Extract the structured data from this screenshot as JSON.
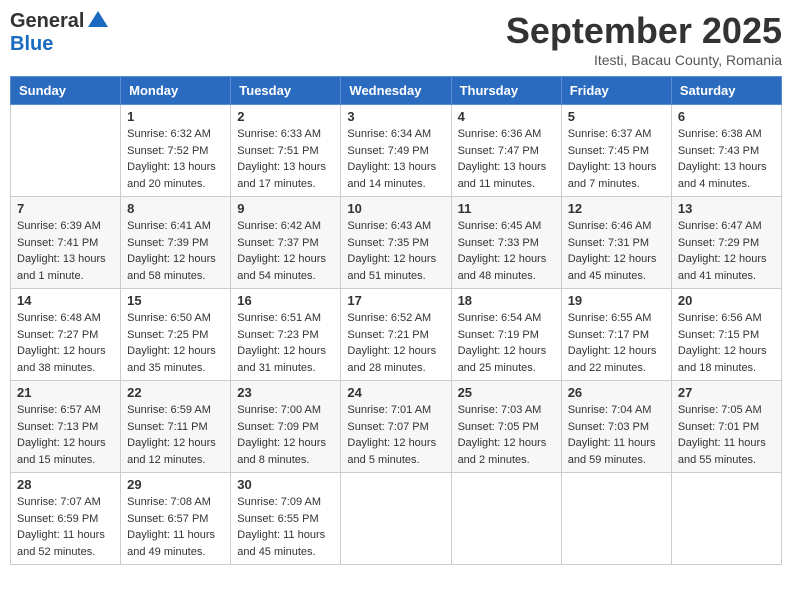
{
  "header": {
    "logo_general": "General",
    "logo_blue": "Blue",
    "month_title": "September 2025",
    "location": "Itesti, Bacau County, Romania"
  },
  "weekdays": [
    "Sunday",
    "Monday",
    "Tuesday",
    "Wednesday",
    "Thursday",
    "Friday",
    "Saturday"
  ],
  "weeks": [
    [
      {
        "day": "",
        "sunrise": "",
        "sunset": "",
        "daylight": ""
      },
      {
        "day": "1",
        "sunrise": "Sunrise: 6:32 AM",
        "sunset": "Sunset: 7:52 PM",
        "daylight": "Daylight: 13 hours and 20 minutes."
      },
      {
        "day": "2",
        "sunrise": "Sunrise: 6:33 AM",
        "sunset": "Sunset: 7:51 PM",
        "daylight": "Daylight: 13 hours and 17 minutes."
      },
      {
        "day": "3",
        "sunrise": "Sunrise: 6:34 AM",
        "sunset": "Sunset: 7:49 PM",
        "daylight": "Daylight: 13 hours and 14 minutes."
      },
      {
        "day": "4",
        "sunrise": "Sunrise: 6:36 AM",
        "sunset": "Sunset: 7:47 PM",
        "daylight": "Daylight: 13 hours and 11 minutes."
      },
      {
        "day": "5",
        "sunrise": "Sunrise: 6:37 AM",
        "sunset": "Sunset: 7:45 PM",
        "daylight": "Daylight: 13 hours and 7 minutes."
      },
      {
        "day": "6",
        "sunrise": "Sunrise: 6:38 AM",
        "sunset": "Sunset: 7:43 PM",
        "daylight": "Daylight: 13 hours and 4 minutes."
      }
    ],
    [
      {
        "day": "7",
        "sunrise": "Sunrise: 6:39 AM",
        "sunset": "Sunset: 7:41 PM",
        "daylight": "Daylight: 13 hours and 1 minute."
      },
      {
        "day": "8",
        "sunrise": "Sunrise: 6:41 AM",
        "sunset": "Sunset: 7:39 PM",
        "daylight": "Daylight: 12 hours and 58 minutes."
      },
      {
        "day": "9",
        "sunrise": "Sunrise: 6:42 AM",
        "sunset": "Sunset: 7:37 PM",
        "daylight": "Daylight: 12 hours and 54 minutes."
      },
      {
        "day": "10",
        "sunrise": "Sunrise: 6:43 AM",
        "sunset": "Sunset: 7:35 PM",
        "daylight": "Daylight: 12 hours and 51 minutes."
      },
      {
        "day": "11",
        "sunrise": "Sunrise: 6:45 AM",
        "sunset": "Sunset: 7:33 PM",
        "daylight": "Daylight: 12 hours and 48 minutes."
      },
      {
        "day": "12",
        "sunrise": "Sunrise: 6:46 AM",
        "sunset": "Sunset: 7:31 PM",
        "daylight": "Daylight: 12 hours and 45 minutes."
      },
      {
        "day": "13",
        "sunrise": "Sunrise: 6:47 AM",
        "sunset": "Sunset: 7:29 PM",
        "daylight": "Daylight: 12 hours and 41 minutes."
      }
    ],
    [
      {
        "day": "14",
        "sunrise": "Sunrise: 6:48 AM",
        "sunset": "Sunset: 7:27 PM",
        "daylight": "Daylight: 12 hours and 38 minutes."
      },
      {
        "day": "15",
        "sunrise": "Sunrise: 6:50 AM",
        "sunset": "Sunset: 7:25 PM",
        "daylight": "Daylight: 12 hours and 35 minutes."
      },
      {
        "day": "16",
        "sunrise": "Sunrise: 6:51 AM",
        "sunset": "Sunset: 7:23 PM",
        "daylight": "Daylight: 12 hours and 31 minutes."
      },
      {
        "day": "17",
        "sunrise": "Sunrise: 6:52 AM",
        "sunset": "Sunset: 7:21 PM",
        "daylight": "Daylight: 12 hours and 28 minutes."
      },
      {
        "day": "18",
        "sunrise": "Sunrise: 6:54 AM",
        "sunset": "Sunset: 7:19 PM",
        "daylight": "Daylight: 12 hours and 25 minutes."
      },
      {
        "day": "19",
        "sunrise": "Sunrise: 6:55 AM",
        "sunset": "Sunset: 7:17 PM",
        "daylight": "Daylight: 12 hours and 22 minutes."
      },
      {
        "day": "20",
        "sunrise": "Sunrise: 6:56 AM",
        "sunset": "Sunset: 7:15 PM",
        "daylight": "Daylight: 12 hours and 18 minutes."
      }
    ],
    [
      {
        "day": "21",
        "sunrise": "Sunrise: 6:57 AM",
        "sunset": "Sunset: 7:13 PM",
        "daylight": "Daylight: 12 hours and 15 minutes."
      },
      {
        "day": "22",
        "sunrise": "Sunrise: 6:59 AM",
        "sunset": "Sunset: 7:11 PM",
        "daylight": "Daylight: 12 hours and 12 minutes."
      },
      {
        "day": "23",
        "sunrise": "Sunrise: 7:00 AM",
        "sunset": "Sunset: 7:09 PM",
        "daylight": "Daylight: 12 hours and 8 minutes."
      },
      {
        "day": "24",
        "sunrise": "Sunrise: 7:01 AM",
        "sunset": "Sunset: 7:07 PM",
        "daylight": "Daylight: 12 hours and 5 minutes."
      },
      {
        "day": "25",
        "sunrise": "Sunrise: 7:03 AM",
        "sunset": "Sunset: 7:05 PM",
        "daylight": "Daylight: 12 hours and 2 minutes."
      },
      {
        "day": "26",
        "sunrise": "Sunrise: 7:04 AM",
        "sunset": "Sunset: 7:03 PM",
        "daylight": "Daylight: 11 hours and 59 minutes."
      },
      {
        "day": "27",
        "sunrise": "Sunrise: 7:05 AM",
        "sunset": "Sunset: 7:01 PM",
        "daylight": "Daylight: 11 hours and 55 minutes."
      }
    ],
    [
      {
        "day": "28",
        "sunrise": "Sunrise: 7:07 AM",
        "sunset": "Sunset: 6:59 PM",
        "daylight": "Daylight: 11 hours and 52 minutes."
      },
      {
        "day": "29",
        "sunrise": "Sunrise: 7:08 AM",
        "sunset": "Sunset: 6:57 PM",
        "daylight": "Daylight: 11 hours and 49 minutes."
      },
      {
        "day": "30",
        "sunrise": "Sunrise: 7:09 AM",
        "sunset": "Sunset: 6:55 PM",
        "daylight": "Daylight: 11 hours and 45 minutes."
      },
      {
        "day": "",
        "sunrise": "",
        "sunset": "",
        "daylight": ""
      },
      {
        "day": "",
        "sunrise": "",
        "sunset": "",
        "daylight": ""
      },
      {
        "day": "",
        "sunrise": "",
        "sunset": "",
        "daylight": ""
      },
      {
        "day": "",
        "sunrise": "",
        "sunset": "",
        "daylight": ""
      }
    ]
  ]
}
